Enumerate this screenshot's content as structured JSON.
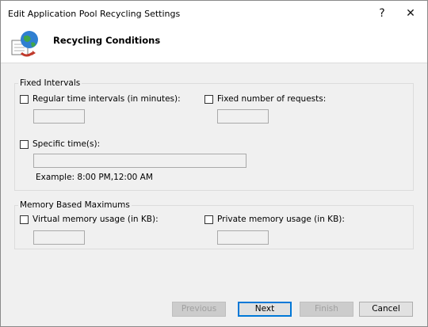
{
  "window": {
    "title": "Edit Application Pool Recycling Settings",
    "help_label": "?",
    "close_label": "✕"
  },
  "header": {
    "title": "Recycling Conditions"
  },
  "fixed": {
    "label": "Fixed Intervals",
    "regular_label": "Regular time intervals (in minutes):",
    "regular_value": "",
    "requests_label": "Fixed number of requests:",
    "requests_value": "",
    "specific_label": "Specific time(s):",
    "specific_value": "",
    "example": "Example: 8:00 PM,12:00 AM"
  },
  "memory": {
    "label": "Memory Based Maximums",
    "virtual_label": "Virtual memory usage (in KB):",
    "virtual_value": "",
    "private_label": "Private memory usage (in KB):",
    "private_value": ""
  },
  "buttons": {
    "previous": "Previous",
    "next": "Next",
    "finish": "Finish",
    "cancel": "Cancel"
  }
}
